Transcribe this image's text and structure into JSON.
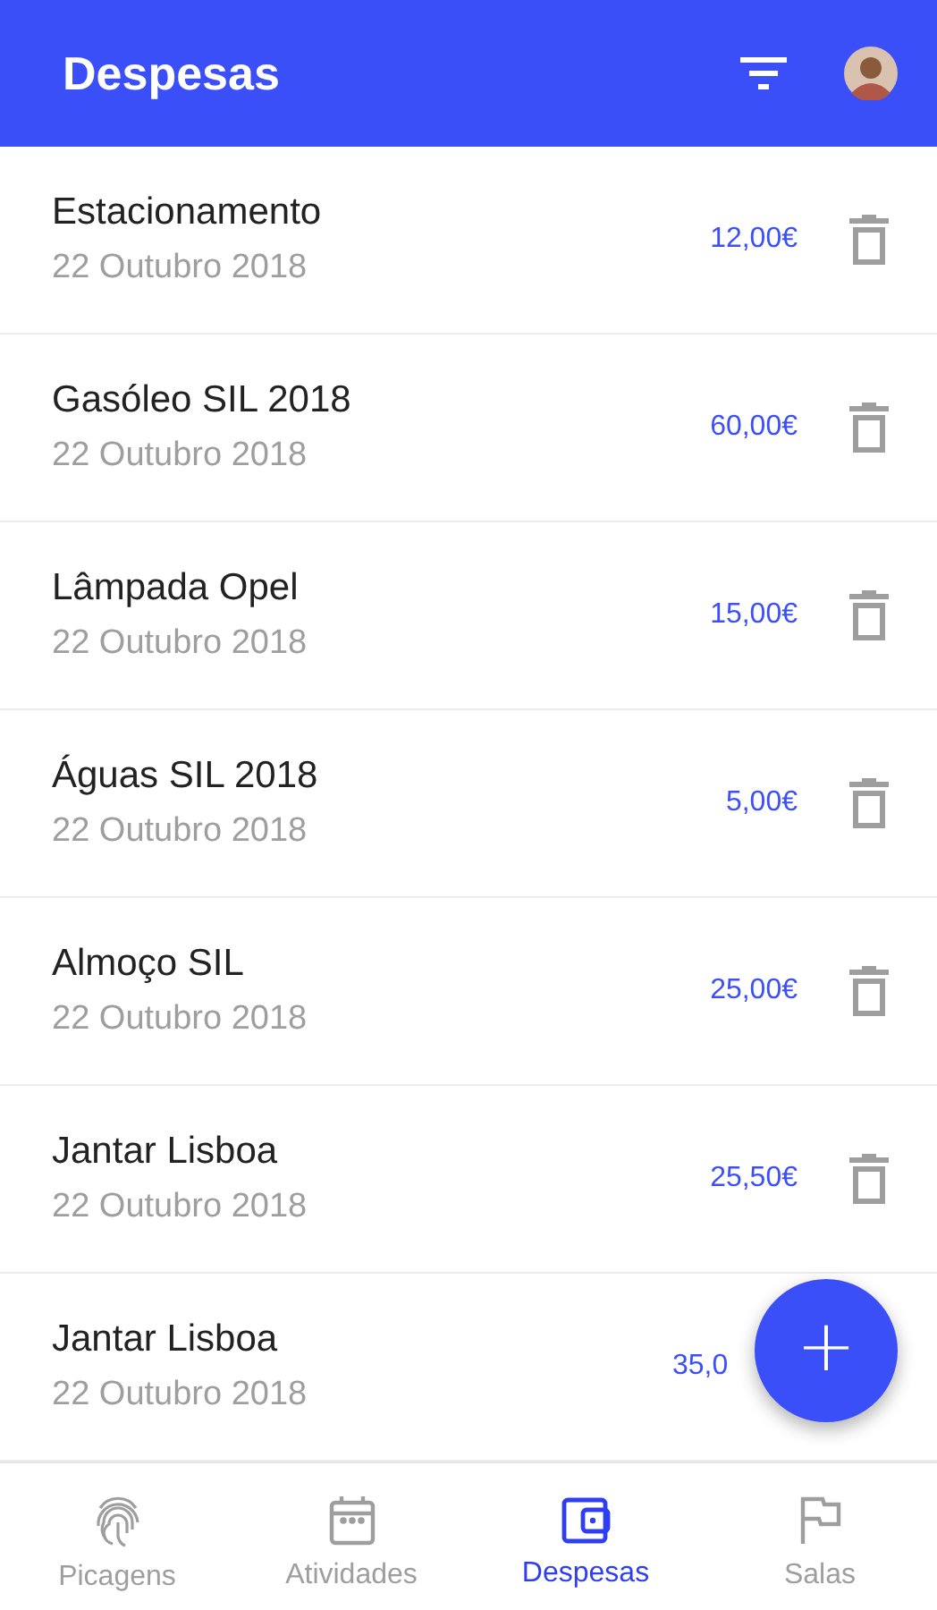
{
  "app_bar": {
    "title": "Despesas"
  },
  "expenses": [
    {
      "name": "Estacionamento",
      "date": "22 Outubro 2018",
      "amount": "12,00€",
      "show_delete": true
    },
    {
      "name": "Gasóleo SIL 2018",
      "date": "22 Outubro 2018",
      "amount": "60,00€",
      "show_delete": true
    },
    {
      "name": "Lâmpada Opel",
      "date": "22 Outubro 2018",
      "amount": "15,00€",
      "show_delete": true
    },
    {
      "name": "Águas SIL 2018",
      "date": "22 Outubro 2018",
      "amount": "5,00€",
      "show_delete": true
    },
    {
      "name": "Almoço SIL",
      "date": "22 Outubro 2018",
      "amount": "25,00€",
      "show_delete": true
    },
    {
      "name": "Jantar Lisboa",
      "date": "22 Outubro 2018",
      "amount": "25,50€",
      "show_delete": true
    },
    {
      "name": "Jantar Lisboa",
      "date": "22 Outubro 2018",
      "amount": "35,0",
      "show_delete": false
    }
  ],
  "fab": {
    "label": "+"
  },
  "bottom_nav": [
    {
      "kind": "fingerprint",
      "label": "Picagens",
      "selected": false
    },
    {
      "kind": "calendar",
      "label": "Atividades",
      "selected": false
    },
    {
      "kind": "wallet",
      "label": "Despesas",
      "selected": true
    },
    {
      "kind": "flag",
      "label": "Salas",
      "selected": false
    }
  ]
}
